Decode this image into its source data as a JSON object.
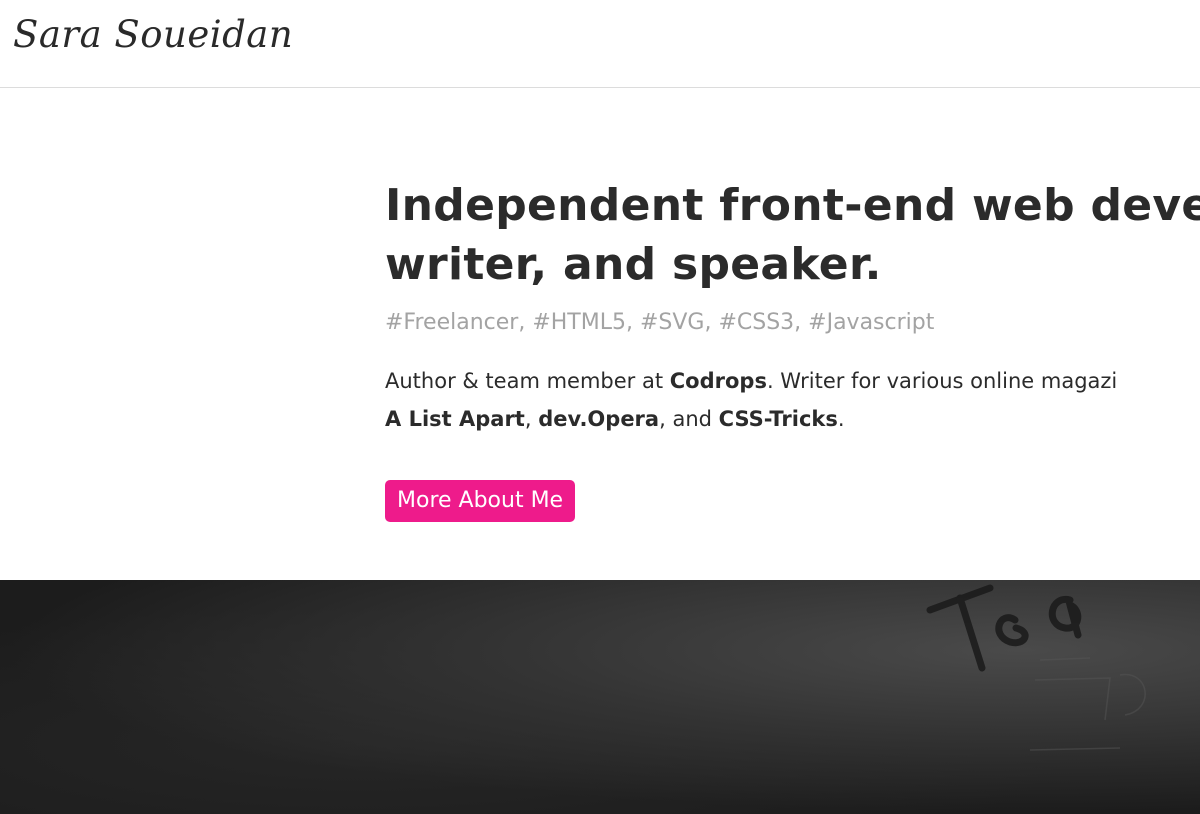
{
  "header": {
    "logo_text": "Sara Soueidan"
  },
  "hero": {
    "headline_line1": "Independent front-end web develo",
    "headline_line2": "writer, and speaker.",
    "tags": "#Freelancer, #HTML5, #SVG, #CSS3, #Javascript",
    "bio": {
      "line1_prefix": "Author & team member at ",
      "line1_link": "Codrops",
      "line1_suffix": ". Writer for various online magazi",
      "line2_link1": "A List Apart",
      "line2_sep1": ", ",
      "line2_link2": "dev.Opera",
      "line2_sep2": ", and ",
      "line2_link3": "CSS-Tricks",
      "line2_end": "."
    },
    "cta_label": "More About Me"
  },
  "colors": {
    "accent": "#ee1b8b",
    "text": "#2b2b2b",
    "muted": "#a3a3a3",
    "dark_band": "#1f1f1f"
  }
}
